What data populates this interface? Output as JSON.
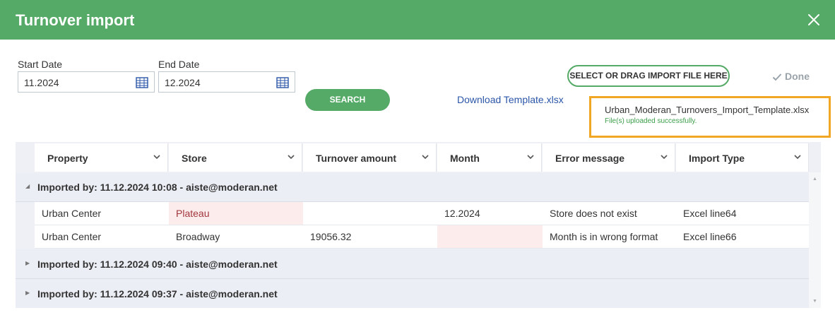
{
  "dialog": {
    "title": "Turnover import"
  },
  "filters": {
    "start_label": "Start Date",
    "start_value": "11.2024",
    "end_label": "End Date",
    "end_value": "12.2024",
    "search_label": "SEARCH"
  },
  "import": {
    "download_link": "Download Template.xlsx",
    "select_label": "SELECT OR DRAG IMPORT FILE HERE",
    "done_label": "Done",
    "file_name": "Urban_Moderan_Turnovers_Import_Template.xlsx",
    "status": "File(s) uploaded successfully."
  },
  "grid": {
    "columns": [
      "Property",
      "Store",
      "Turnover amount",
      "Month",
      "Error message",
      "Import Type"
    ],
    "groups": [
      {
        "label": "Imported by: 11.12.2024 10:08 - aiste@moderan.net",
        "expanded": true,
        "rows": [
          {
            "property": "Urban Center",
            "store": "Plateau",
            "amount": "",
            "month": "12.2024",
            "error": "Store does not exist",
            "type": "Excel line64"
          },
          {
            "property": "Urban Center",
            "store": "Broadway",
            "amount": "19056.32",
            "month": "",
            "error": "Month is in wrong format",
            "type": "Excel line66"
          }
        ]
      },
      {
        "label": "Imported by: 11.12.2024 09:40 - aiste@moderan.net",
        "expanded": false
      },
      {
        "label": "Imported by: 11.12.2024 09:37 - aiste@moderan.net",
        "expanded": false
      }
    ]
  },
  "colors": {
    "header": "#54aa66",
    "highlight_border": "#f2a724",
    "error_cell": "#fdecec",
    "link": "#2b56a8"
  },
  "icons": [
    "close-icon",
    "calendar-icon",
    "check-icon",
    "chevron-down-icon",
    "caret-down-icon",
    "caret-right-icon"
  ]
}
